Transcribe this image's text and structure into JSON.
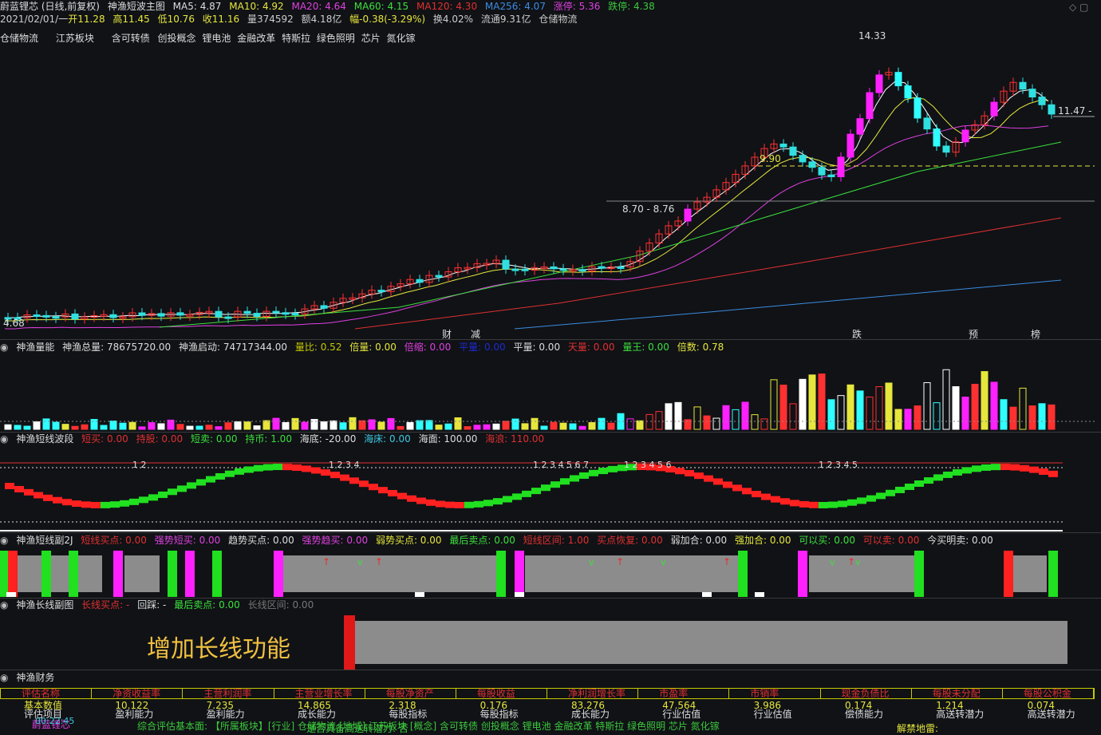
{
  "title_bar": {
    "stock": "蔚蓝锂芯 (日线,前复权)",
    "indicator": "神渔短波主图",
    "ma5": "MA5: 4.87",
    "ma10": "MA10: 4.92",
    "ma20": "MA20: 4.64",
    "ma60": "MA60: 4.15",
    "ma120": "MA120: 4.30",
    "ma256": "MA256: 4.07",
    "limit_up": "涨停: 5.36",
    "limit_down": "跌停: 4.38"
  },
  "quote_line": {
    "date": "2021/02/01/一",
    "open": "开11.28",
    "high": "高11.45",
    "low": "低10.76",
    "close": "收11.16",
    "volume": "量374592",
    "amount": "额4.18亿",
    "change": "幅-0.38(-3.29%)",
    "turnover": "换4.02%",
    "float": "流通9.31亿",
    "sector": "仓储物流"
  },
  "concepts": [
    "仓储物流",
    "江苏板块",
    "含可转债",
    "创投概念",
    "锂电池",
    "金融改革",
    "特斯拉",
    "绿色照明",
    "芯片",
    "氮化镓"
  ],
  "price_labels": {
    "high": "14.33",
    "last": "11.47 -",
    "low_start": "4.68",
    "mid_a": "9.90",
    "mid_b": "8.70 - 8.76"
  },
  "markers": [
    "财",
    "减",
    "跌",
    "预",
    "榜"
  ],
  "panel1": {
    "name": "神渔量能",
    "total": "神渔总量: 78675720.00",
    "start": "神渔启动: 74717344.00",
    "ratio": "量比: 0.52",
    "double": "倍量: 0.00",
    "dbl_neg": "倍缩: 0.00",
    "flat_lbl": "平量: 0.00",
    "flat": "平量: 0.00",
    "sky": "天量: 0.00",
    "king": "量王: 0.00",
    "times": "倍数: 0.78"
  },
  "panel2": {
    "name": "神渔短线波段",
    "buy": "短买: 0.00",
    "hold": "持股: 0.00",
    "sell": "短卖: 0.00",
    "hold_coin": "持币: 1.00",
    "sea_bottom": "海底: -20.00",
    "sea_bed": "海床: 0.00",
    "sea_surface": "海面: 100.00",
    "sea_wave": "海浪: 110.00",
    "wave_labels": [
      "1 2",
      "1 2 3 4",
      "1 2 3 4 5 6 7",
      "1 2 3 4 5 6",
      "1 2 3 4 5"
    ]
  },
  "panel3": {
    "name": "神渔短线副2J",
    "s1": "短线买点: 0.00",
    "s2": "强势短买: 0.00",
    "s3": "趋势买点: 0.00",
    "s4": "强势趋买: 0.00",
    "s5": "弱势买点: 0.00",
    "s6": "最后卖点: 0.00",
    "s7": "短线区间: 1.00",
    "s8": "买点恢复: 0.00",
    "s9": "弱加合: 0.00",
    "s10": "强加合: 0.00",
    "s11": "可以买: 0.00",
    "s12": "可以卖: 0.00",
    "s13": "今买明卖: 0.00"
  },
  "panel4": {
    "name": "神渔长线副图",
    "a": "长线买点: -",
    "b": "回踩: -",
    "c": "最后卖点: 0.00",
    "d": "长线区间: 0.00",
    "banner": "增加长线功能"
  },
  "panel5": {
    "name": "神渔财务"
  },
  "table": {
    "headers": [
      "评估名称",
      "净资收益率",
      "主营利润率",
      "主营业增长率",
      "每股净资产",
      "每股收益",
      "净利润增长率",
      "市盈率",
      "市销率",
      "现金负债比",
      "每股未分配",
      "每股公积金"
    ],
    "row1": [
      "基本数值",
      "10.122",
      "7.235",
      "14.865",
      "2.318",
      "0.176",
      "83.276",
      "47.564",
      "3.986",
      "0.174",
      "1.214",
      "0.074"
    ],
    "row2": [
      "评估项目",
      "盈利能力",
      "盈利能力",
      "成长能力",
      "每股指标",
      "每股指标",
      "成长能力",
      "行业估值",
      "行业估值",
      "偿债能力",
      "高送转潜力",
      "高送转潜力"
    ]
  },
  "footer": {
    "name": "蔚蓝锂芯",
    "time": "00:22:45",
    "bar": "综合评估基本面: 【所属板块】[行业] 仓储物流 [地域] 江苏板块 [概念] 含可转债 创投概念 锂电池 金融改革 特斯拉 绿色照明 芯片 氮化镓",
    "risk": "是否具备高送转潜力: 否",
    "ban": "解禁地雷:"
  }
}
